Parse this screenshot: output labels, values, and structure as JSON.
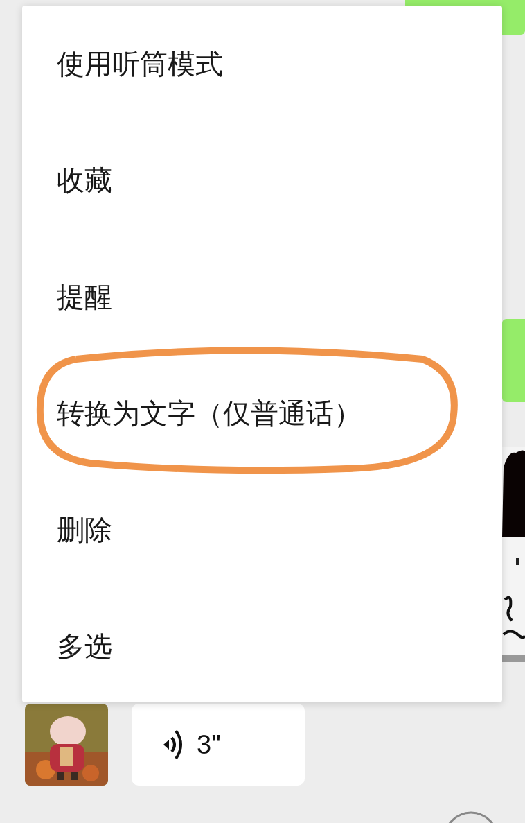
{
  "menu": {
    "items": [
      {
        "label": "使用听筒模式",
        "circled": false
      },
      {
        "label": "收藏",
        "circled": false
      },
      {
        "label": "提醒",
        "circled": false
      },
      {
        "label": "转换为文字（仅普通话）",
        "circled": true
      },
      {
        "label": "删除",
        "circled": false
      },
      {
        "label": "多选",
        "circled": false
      }
    ]
  },
  "voice_message": {
    "duration": "3\""
  }
}
